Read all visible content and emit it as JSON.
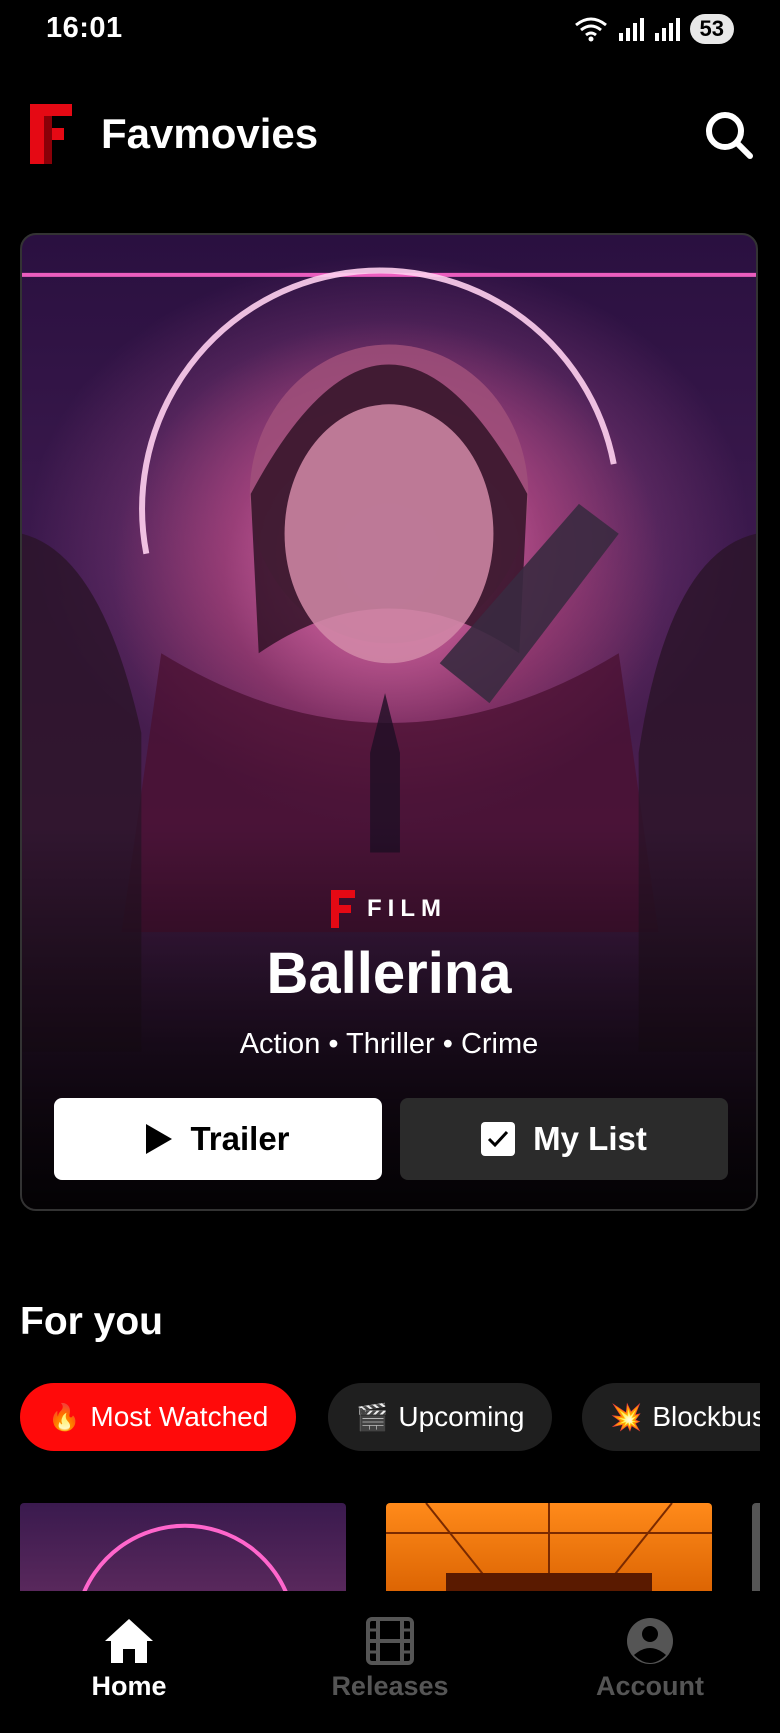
{
  "status": {
    "time": "16:01",
    "battery": "53"
  },
  "app": {
    "title": "Favmovies"
  },
  "hero": {
    "badge": "FILM",
    "title": "Ballerina",
    "genres": "Action • Thriller • Crime",
    "trailer_label": "Trailer",
    "mylist_label": "My List"
  },
  "section": {
    "title": "For you"
  },
  "chips": [
    {
      "emoji": "🔥",
      "label": "Most Watched",
      "active": true
    },
    {
      "emoji": "🎬",
      "label": "Upcoming",
      "active": false
    },
    {
      "emoji": "💥",
      "label": "Blockbus",
      "active": false
    }
  ],
  "nav": [
    {
      "label": "Home",
      "icon": "home-icon",
      "active": true
    },
    {
      "label": "Releases",
      "icon": "film-icon",
      "active": false
    },
    {
      "label": "Account",
      "icon": "account-icon",
      "active": false
    }
  ],
  "colors": {
    "accent": "#ff0a0a",
    "brand_f": "#e50914",
    "background": "#000000"
  }
}
